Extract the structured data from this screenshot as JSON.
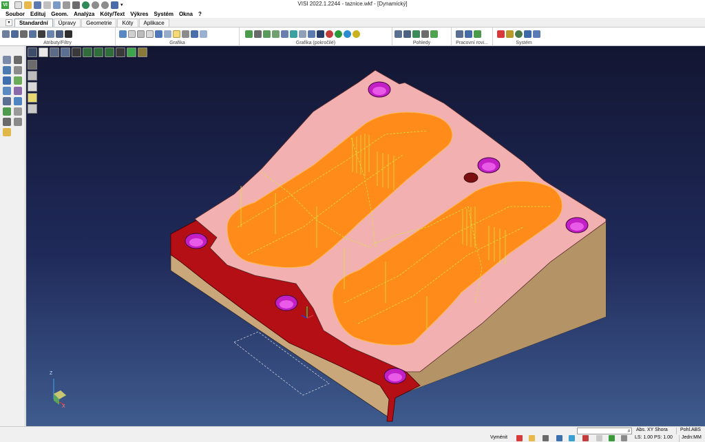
{
  "window": {
    "title": "VISI 2022.1.2244 - taznice.wkf - [Dynamický]",
    "logo_text": "VI"
  },
  "menu": [
    "Soubor",
    "Edituj",
    "Geom.",
    "Analýza",
    "Kóty/Text",
    "Výkres",
    "Systém",
    "Okna",
    "?"
  ],
  "tabs": [
    {
      "label": "Standardní",
      "active": true
    },
    {
      "label": "Úpravy",
      "active": false
    },
    {
      "label": "Geometrie",
      "active": false
    },
    {
      "label": "Kóty",
      "active": false
    },
    {
      "label": "Aplikace",
      "active": false
    }
  ],
  "ribbon_groups": [
    {
      "label": "Atributy/Filtry"
    },
    {
      "label": "Grafika"
    },
    {
      "label": "Grafika (pokročilé)"
    },
    {
      "label": "Pohledy"
    },
    {
      "label": "Pracovní rovi..."
    },
    {
      "label": "Systém"
    }
  ],
  "axis": {
    "z": "Z",
    "x": "X"
  },
  "status": {
    "view_label": "Abs. XY Shora",
    "projection": "Pohl.ABS",
    "clear_label": "Vyménit",
    "ls_ps": "LS: 1.00 PS: 1.00",
    "units": "Jedn:MM"
  },
  "colors": {
    "title_bg": "#ffffff",
    "viewport_top": "#131632",
    "viewport_bottom": "#3f5b8e",
    "mold_plate": "#f2b2b2",
    "cavity": "#ff8c1a",
    "side_panel": "#c8a878",
    "front_red": "#b80f14",
    "holes": "#cc22cc",
    "toolpath": "#d6e43a"
  }
}
